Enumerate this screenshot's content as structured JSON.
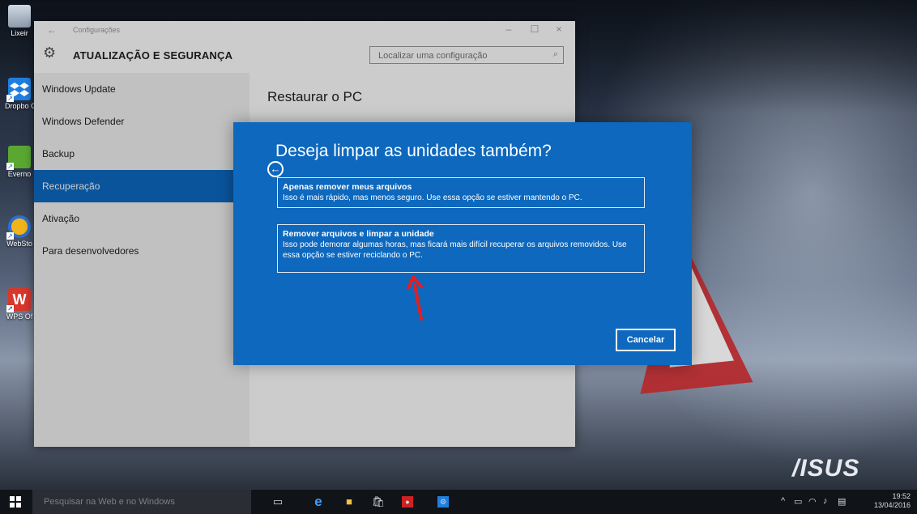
{
  "desktop": {
    "icons": [
      {
        "label": "Lixeir",
        "icon": "recycle-bin-icon"
      },
      {
        "label": "Dropbo GB",
        "icon": "dropbox-icon"
      },
      {
        "label": "Everno",
        "icon": "evernote-icon"
      },
      {
        "label": "WebSto",
        "icon": "webstorage-icon"
      },
      {
        "label": "WPS Of",
        "icon": "wps-office-icon"
      }
    ],
    "brand": "/ISUS"
  },
  "settings": {
    "window_title": "Configurações",
    "header_title": "ATUALIZAÇÃO E SEGURANÇA",
    "search_placeholder": "Localizar uma configuração",
    "sidebar": [
      {
        "label": "Windows Update",
        "active": false
      },
      {
        "label": "Windows Defender",
        "active": false
      },
      {
        "label": "Backup",
        "active": false
      },
      {
        "label": "Recuperação",
        "active": true
      },
      {
        "label": "Ativação",
        "active": false
      },
      {
        "label": "Para desenvolvedores",
        "active": false
      }
    ],
    "content_title": "Restaurar o PC"
  },
  "dialog": {
    "title": "Deseja limpar as unidades também?",
    "option1": {
      "heading": "Apenas remover meus arquivos",
      "description": "Isso é mais rápido, mas menos seguro. Use essa opção se estiver mantendo o PC."
    },
    "option2": {
      "heading": "Remover arquivos e limpar a unidade",
      "description": "Isso pode demorar algumas horas, mas ficará mais difícil recuperar os arquivos removidos. Use essa opção se estiver reciclando o PC."
    },
    "cancel_label": "Cancelar"
  },
  "taskbar": {
    "search_placeholder": "Pesquisar na Web e no Windows",
    "time": "19:52",
    "date": "13/04/2016"
  },
  "colors": {
    "accent": "#0d68be",
    "sidebar_active": "#0d6ac4",
    "arrow": "#e02020"
  }
}
